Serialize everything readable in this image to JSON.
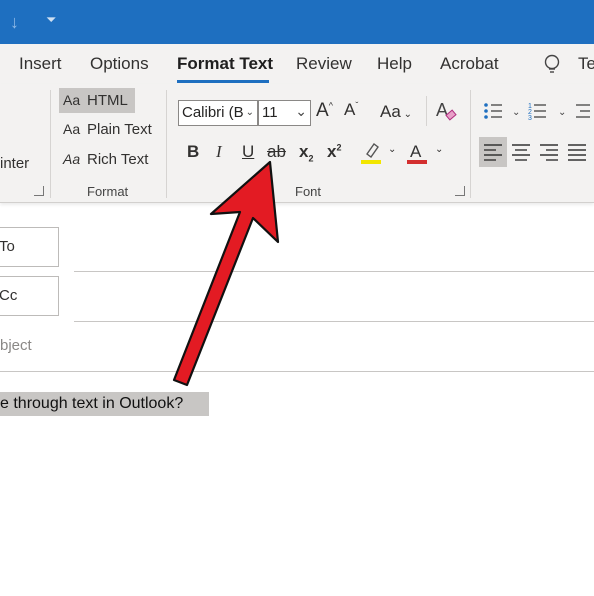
{
  "tabs": [
    "Insert",
    "Options",
    "Format Text",
    "Review",
    "Help",
    "Acrobat",
    "Te"
  ],
  "active_tab": "Format Text",
  "ribbon": {
    "clipboard": {
      "format_painter_partial": "inter"
    },
    "format_group": {
      "label": "Format",
      "html_option": "HTML",
      "plain_text_option": "Plain Text",
      "rich_text_option": "Rich Text",
      "selected": "HTML"
    },
    "font_group": {
      "label": "Font",
      "font_name": "Calibri (B",
      "font_size": "11",
      "change_case": "Aa",
      "bold": "B",
      "italic": "I",
      "underline": "U",
      "strikethrough": "ab",
      "subscript": "x",
      "superscript": "x",
      "highlight_color": "#f2e600",
      "font_color": "#d32f2f"
    }
  },
  "compose": {
    "to_label": "To",
    "cc_label": "Cc",
    "subject_placeholder": "bject",
    "body_text": "e through text in Outlook?"
  },
  "annotation": {
    "arrow_color": "#e31b23",
    "points_to": "strikethrough-button"
  },
  "colors": {
    "titlebar": "#1e6fc0",
    "ribbon_bg": "#f3f2f1",
    "selection": "#c8c6c4"
  }
}
